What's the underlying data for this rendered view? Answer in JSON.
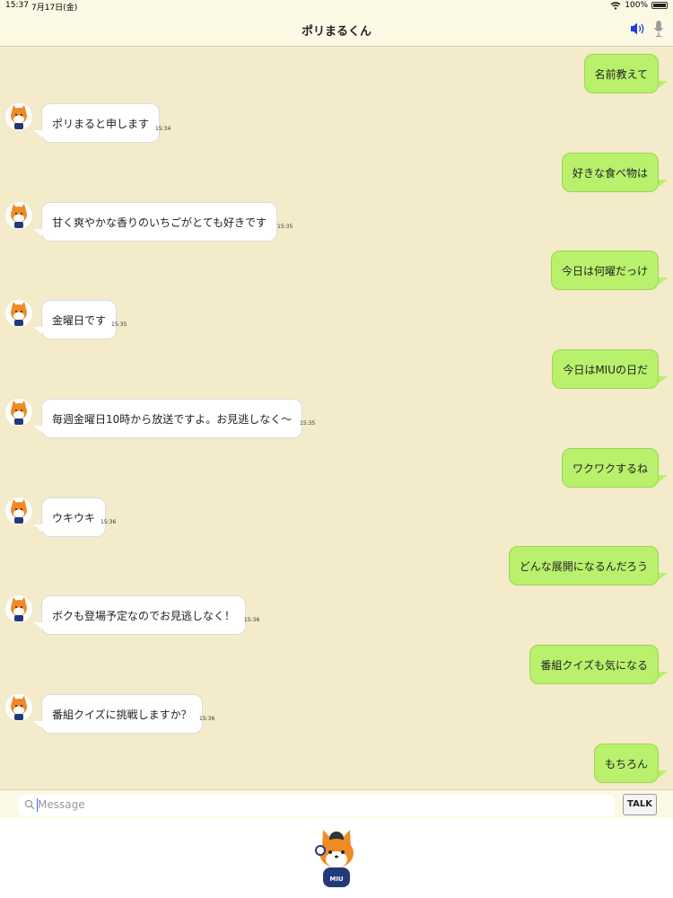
{
  "status_bar": {
    "time": "15:37",
    "date": "7月17日(金)",
    "battery": "100%"
  },
  "nav": {
    "title": "ポリまるくん"
  },
  "messages": [
    {
      "from": "me",
      "text": "名前教えて"
    },
    {
      "from": "bot",
      "text": "ポリまると申します",
      "time": "15:34"
    },
    {
      "from": "me",
      "text": "好きな食べ物は"
    },
    {
      "from": "bot",
      "text": "甘く爽やかな香りのいちごがとても好きです",
      "time": "15:35"
    },
    {
      "from": "me",
      "text": "今日は何曜だっけ"
    },
    {
      "from": "bot",
      "text": "金曜日です",
      "time": "15:35"
    },
    {
      "from": "me",
      "text": "今日はMIUの日だ"
    },
    {
      "from": "bot",
      "text": "毎週金曜日10時から放送ですよ。お見逃しなく〜",
      "time": "15:35"
    },
    {
      "from": "me",
      "text": "ワクワクするね"
    },
    {
      "from": "bot",
      "text": "ウキウキ",
      "time": "15:36"
    },
    {
      "from": "me",
      "text": "どんな展開になるんだろう"
    },
    {
      "from": "bot",
      "text": "ボクも登場予定なのでお見逃しなく！",
      "time": "15:36"
    },
    {
      "from": "me",
      "text": "番組クイズも気になる"
    },
    {
      "from": "bot",
      "text": "番組クイズに挑戦しますか？",
      "time": "15:36"
    },
    {
      "from": "me",
      "text": "もちろん"
    }
  ],
  "input": {
    "placeholder": "Message",
    "talk_label": "TALK"
  },
  "mascot": {
    "shirt_text": "MIU"
  },
  "colors": {
    "background": "#f3ebca",
    "user_bubble": "#b9f06c",
    "bot_bubble": "#ffffff"
  }
}
